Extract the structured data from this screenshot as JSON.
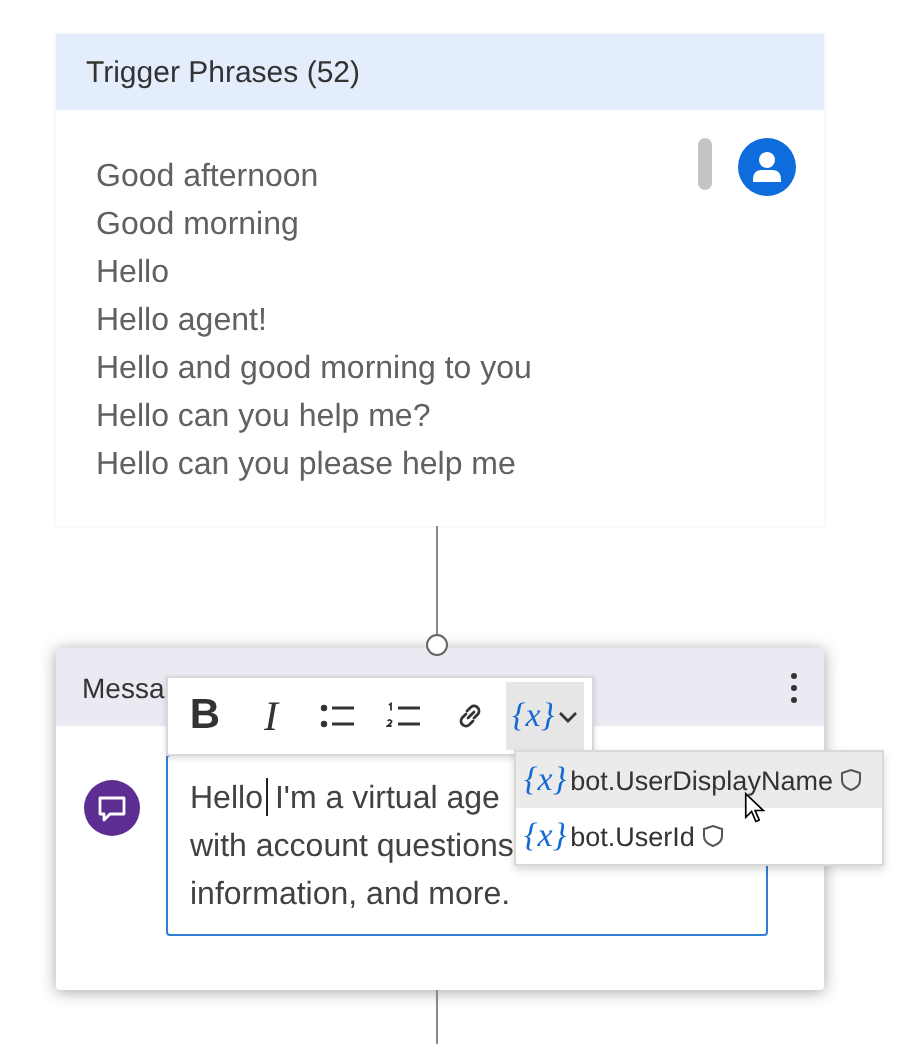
{
  "trigger_card": {
    "title": "Trigger Phrases (52)",
    "phrases": [
      "Good afternoon",
      "Good morning",
      "Hello",
      "Hello agent!",
      "Hello and good morning to you",
      "Hello can you help me?",
      "Hello can you please help me"
    ]
  },
  "message_card": {
    "title": "Messa",
    "before_caret": "Hello",
    "after_caret": [
      "I'm a virtual age",
      "with account questions",
      "information, and more."
    ]
  },
  "toolbar": [
    {
      "kind": "bold",
      "label": "B",
      "selected": false
    },
    {
      "kind": "italic",
      "label": "I",
      "selected": false
    },
    {
      "kind": "bullets",
      "selected": false
    },
    {
      "kind": "numbered",
      "selected": false
    },
    {
      "kind": "link",
      "selected": false
    },
    {
      "kind": "variable",
      "label": "{x}",
      "selected": true
    }
  ],
  "variables": [
    {
      "prefix": "{x}",
      "label": "bot.UserDisplayName",
      "selected": true
    },
    {
      "prefix": "{x}",
      "label": "bot.UserId",
      "selected": false
    }
  ]
}
